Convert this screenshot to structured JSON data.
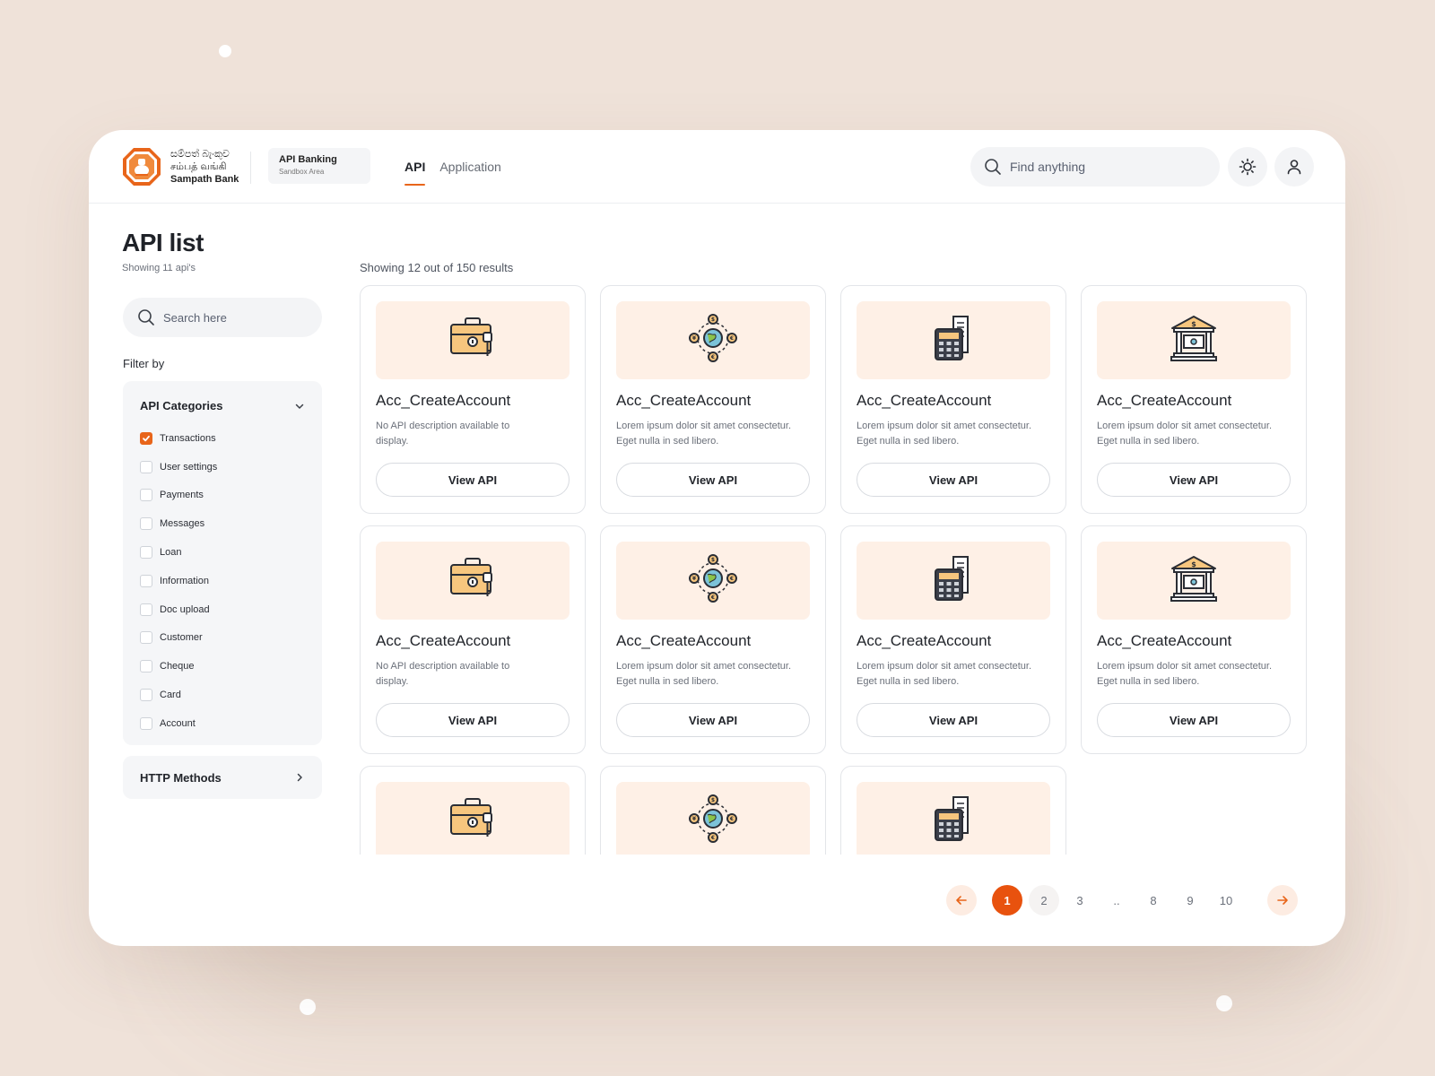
{
  "brand": {
    "logo_line1": "සම්පත් බැංකුව",
    "logo_line2": "சம்பத் வங்கி",
    "logo_line3": "Sampath Bank",
    "env_title": "API Banking",
    "env_sub": "Sandbox Area"
  },
  "nav": {
    "tabs": [
      {
        "label": "API"
      },
      {
        "label": "Application"
      }
    ]
  },
  "search": {
    "placeholder": "Find anything"
  },
  "sidebar": {
    "title": "API list",
    "subtitle": "Showing 11 api's",
    "search_placeholder": "Search here",
    "filter_label": "Filter by",
    "categories_label": "API Categories",
    "categories": [
      {
        "label": "Transactions",
        "checked": true
      },
      {
        "label": "User settings",
        "checked": false
      },
      {
        "label": "Payments",
        "checked": false
      },
      {
        "label": "Messages",
        "checked": false
      },
      {
        "label": "Loan",
        "checked": false
      },
      {
        "label": "Information",
        "checked": false
      },
      {
        "label": "Doc upload",
        "checked": false
      },
      {
        "label": "Customer",
        "checked": false
      },
      {
        "label": "Cheque",
        "checked": false
      },
      {
        "label": "Card",
        "checked": false
      },
      {
        "label": "Account",
        "checked": false
      }
    ],
    "http_label": "HTTP Methods"
  },
  "results": {
    "count_text": "Showing 12 out of 150 results",
    "view_label": "View API",
    "cards": [
      {
        "title": "Acc_CreateAccount",
        "desc": "No API description available to display.",
        "icon": "briefcase-key-icon"
      },
      {
        "title": "Acc_CreateAccount",
        "desc": "Lorem ipsum dolor sit amet consectetur. Eget nulla in sed libero.",
        "icon": "globe-currency-icon"
      },
      {
        "title": "Acc_CreateAccount",
        "desc": "Lorem ipsum dolor sit amet consectetur. Eget nulla in sed libero.",
        "icon": "calculator-icon"
      },
      {
        "title": "Acc_CreateAccount",
        "desc": "Lorem ipsum dolor sit amet consectetur. Eget nulla in sed libero.",
        "icon": "bank-building-icon"
      },
      {
        "title": "Acc_CreateAccount",
        "desc": "No API description available to display.",
        "icon": "briefcase-key-icon"
      },
      {
        "title": "Acc_CreateAccount",
        "desc": "Lorem ipsum dolor sit amet consectetur. Eget nulla in sed libero.",
        "icon": "globe-currency-icon"
      },
      {
        "title": "Acc_CreateAccount",
        "desc": "Lorem ipsum dolor sit amet consectetur. Eget nulla in sed libero.",
        "icon": "calculator-icon"
      },
      {
        "title": "Acc_CreateAccount",
        "desc": "Lorem ipsum dolor sit amet consectetur. Eget nulla in sed libero.",
        "icon": "bank-building-icon"
      },
      {
        "title": "",
        "desc": "",
        "icon": "briefcase-key-icon"
      },
      {
        "title": "",
        "desc": "",
        "icon": "globe-currency-icon"
      },
      {
        "title": "",
        "desc": "",
        "icon": "calculator-icon"
      }
    ]
  },
  "pagination": {
    "pages": [
      "1",
      "2",
      "3",
      "..",
      "8",
      "9",
      "10"
    ],
    "current": "1"
  },
  "colors": {
    "accent": "#e8651a",
    "card_tint": "#fef0e6",
    "background": "#efe2d9"
  }
}
